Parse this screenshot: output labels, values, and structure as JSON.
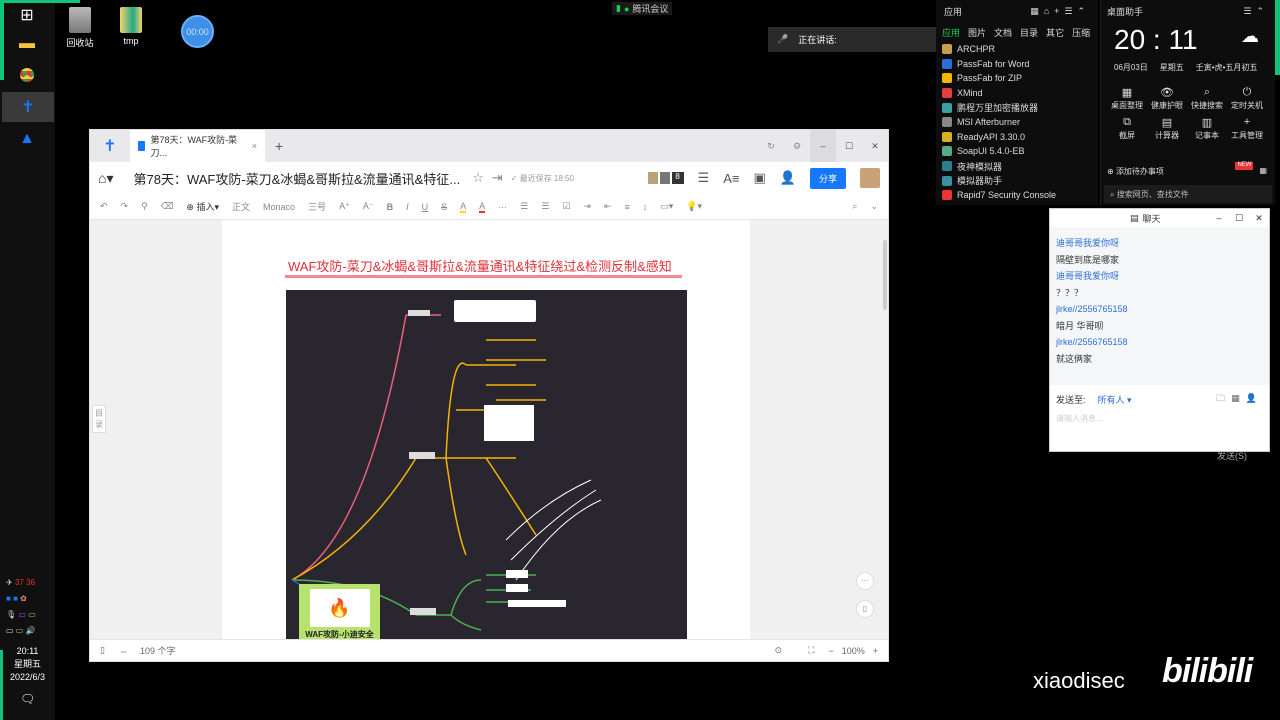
{
  "desktop": {
    "icons": [
      {
        "label": "回收站",
        "icon": "recycle-bin-icon"
      },
      {
        "label": "tmp",
        "icon": "folder-icon"
      }
    ],
    "timer": "00:00",
    "meeting_label": "腾讯会议",
    "speaking_label": "正在讲话:"
  },
  "taskbar": {
    "clock_time": "20:11",
    "clock_weekday": "星期五",
    "clock_date": "2022/6/3",
    "tray_temp1": "37",
    "tray_temp2": "36"
  },
  "window": {
    "tab_title": "第78天：WAF攻防-菜刀...",
    "doc_title": "第78天：WAF攻防-菜刀&冰蝎&哥斯拉&流量通讯&特征...",
    "save_status": "最近保存 18:50",
    "collab_count": "8",
    "share_label": "分享",
    "toolbar": {
      "insert": "插入",
      "style": "正文",
      "font": "Monaco",
      "size": "三号"
    },
    "outline_label": "目录",
    "doc_heading": "WAF攻防-菜刀&冰蝎&哥斯拉&流量通讯&特征绕过&检测反制&感知",
    "mindmap_root": "WAF攻防-小迪安全",
    "word_count": "109 个字",
    "zoom": "100%",
    "colors": {
      "accent": "#1677ff",
      "heading": "#e0303a",
      "mindmap_bg": "#2a2630"
    }
  },
  "apps_panel": {
    "title": "应用",
    "tabs": [
      "应用",
      "图片",
      "文档",
      "目录",
      "其它",
      "压缩"
    ],
    "items": [
      "ARCHPR",
      "PassFab for Word",
      "PassFab for ZIP",
      "XMind",
      "鹏程万里加密播放器",
      "MSI Afterburner",
      "ReadyAPI 3.30.0",
      "SoapUI 5.4.0-EB",
      "夜神模拟器",
      "模拟器助手",
      "Rapid7 Security Console"
    ]
  },
  "assistant": {
    "title": "桌面助手",
    "time": "20 : 11",
    "date": "06月03日",
    "weekday": "星期五",
    "lunar": "壬寅•虎•五月初五",
    "tools": [
      "桌面整理",
      "健康护眼",
      "快捷搜索",
      "定时关机",
      "截屏",
      "计算器",
      "记事本",
      "工具管理"
    ],
    "todo": "添加待办事项",
    "badge": "NEW",
    "search_placeholder": "搜索网页、查找文件"
  },
  "chat": {
    "title": "聊天",
    "messages": [
      {
        "text": "迪哥哥我爱你呀",
        "sender": true
      },
      {
        "text": "隔壁到底是哪家",
        "sender": false
      },
      {
        "text": "迪哥哥我爱你呀",
        "sender": true
      },
      {
        "text": "？？？",
        "sender": false
      },
      {
        "text": "jlrke//2556765158",
        "sender": true
      },
      {
        "text": "暗月 华哥呗",
        "sender": false
      },
      {
        "text": "jlrke//2556765158",
        "sender": true
      },
      {
        "text": "就这俩家",
        "sender": false
      }
    ],
    "send_to_label": "发送至:",
    "send_to_value": "所有人",
    "input_placeholder": "请输入消息...",
    "send_button": "发送(S)"
  },
  "watermark": {
    "text": "xiaodisec",
    "logo": "bilibili"
  }
}
